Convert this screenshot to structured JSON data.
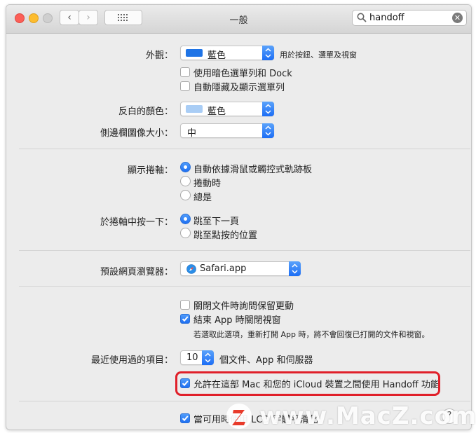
{
  "window": {
    "title": "一般"
  },
  "search": {
    "value": "handoff"
  },
  "appearance": {
    "label": "外觀：",
    "value": "藍色",
    "note": "用於按鈕、選單及視窗",
    "swatch_color": "#1f74e6"
  },
  "dark_menu": {
    "label": "使用暗色選單列和 Dock",
    "checked": false
  },
  "autohide_menu": {
    "label": "自動隱藏及顯示選單列",
    "checked": false
  },
  "highlight_color": {
    "label": "反白的顏色：",
    "value": "藍色",
    "swatch_color": "#a9cdf5"
  },
  "sidebar_icon_size": {
    "label": "側邊欄圖像大小：",
    "value": "中"
  },
  "show_scrollbars": {
    "label": "顯示捲軸：",
    "options": [
      "自動依據滑鼠或觸控式軌跡板",
      "捲動時",
      "總是"
    ],
    "selected": 0
  },
  "click_scrollbar": {
    "label": "於捲軸中按一下：",
    "options": [
      "跳至下一頁",
      "跳至點按的位置"
    ],
    "selected": 0
  },
  "default_browser": {
    "label": "預設網頁瀏覽器：",
    "value": "Safari.app"
  },
  "ask_keep_changes": {
    "label": "關閉文件時詢問保留更動",
    "checked": false
  },
  "close_windows": {
    "label": "結束 App 時關閉視窗",
    "checked": true
  },
  "close_windows_note": "若選取此選項，重新打開 App 時，將不會回復已打開的文件和視窗。",
  "recent_items": {
    "label": "最近使用過的項目：",
    "value": "10",
    "suffix": "個文件、App 和伺服器"
  },
  "handoff": {
    "label": "允許在這部 Mac 和您的 iCloud 裝置之間使用 Handoff 功能",
    "checked": true
  },
  "lcd_smoothing": {
    "label": "當可用時使用 LCD 字體平滑化",
    "checked": true
  },
  "watermark": {
    "text": "www.MacZ.com",
    "logo_letter": "Z"
  },
  "colors": {
    "accent": "#1e6ff2",
    "highlight_border": "#e0202a"
  }
}
